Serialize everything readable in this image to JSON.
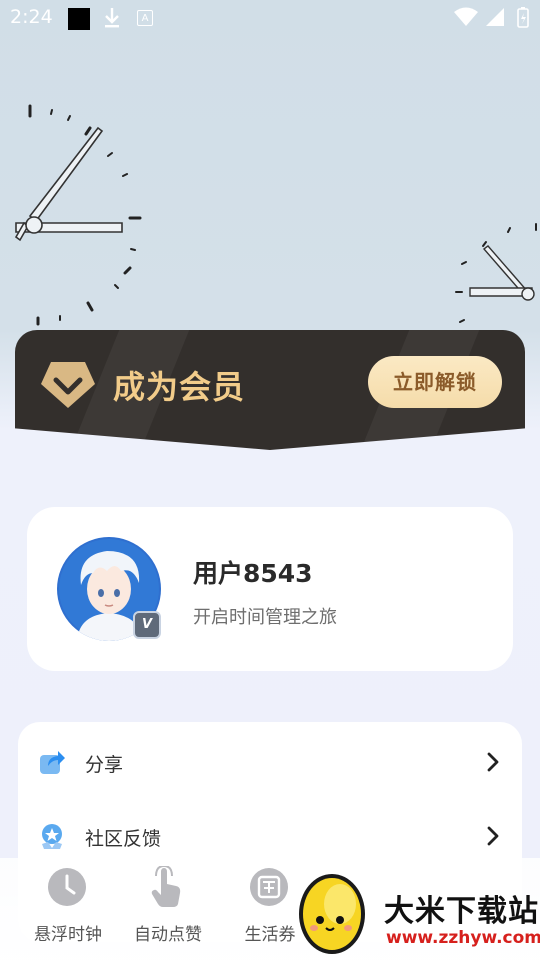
{
  "status": {
    "time": "2:24",
    "icons": [
      "black-square",
      "download-icon",
      "a-icon",
      "wifi-icon",
      "signal-icon",
      "battery-icon"
    ]
  },
  "vip": {
    "title": "成为会员",
    "button": "立即解锁",
    "gem_icon": "diamond-icon"
  },
  "profile": {
    "name": "用户8543",
    "subtitle": "开启时间管理之旅",
    "badge": "V"
  },
  "menu": [
    {
      "label": "分享",
      "icon": "share-icon"
    },
    {
      "label": "社区反馈",
      "icon": "feedback-icon"
    }
  ],
  "tabs": [
    {
      "label": "悬浮时钟",
      "icon": "clock-icon"
    },
    {
      "label": "自动点赞",
      "icon": "tap-hand-icon"
    },
    {
      "label": "生活券",
      "icon": "coupon-icon"
    }
  ],
  "watermark": {
    "title": "大米下载站",
    "url": "www.zzhyw.com"
  },
  "colors": {
    "vip_bg": "#332f2c",
    "vip_gold": "#f2cc8a",
    "vip_button": "#f8e2b5",
    "accent_blue": "#3aa3ee"
  }
}
